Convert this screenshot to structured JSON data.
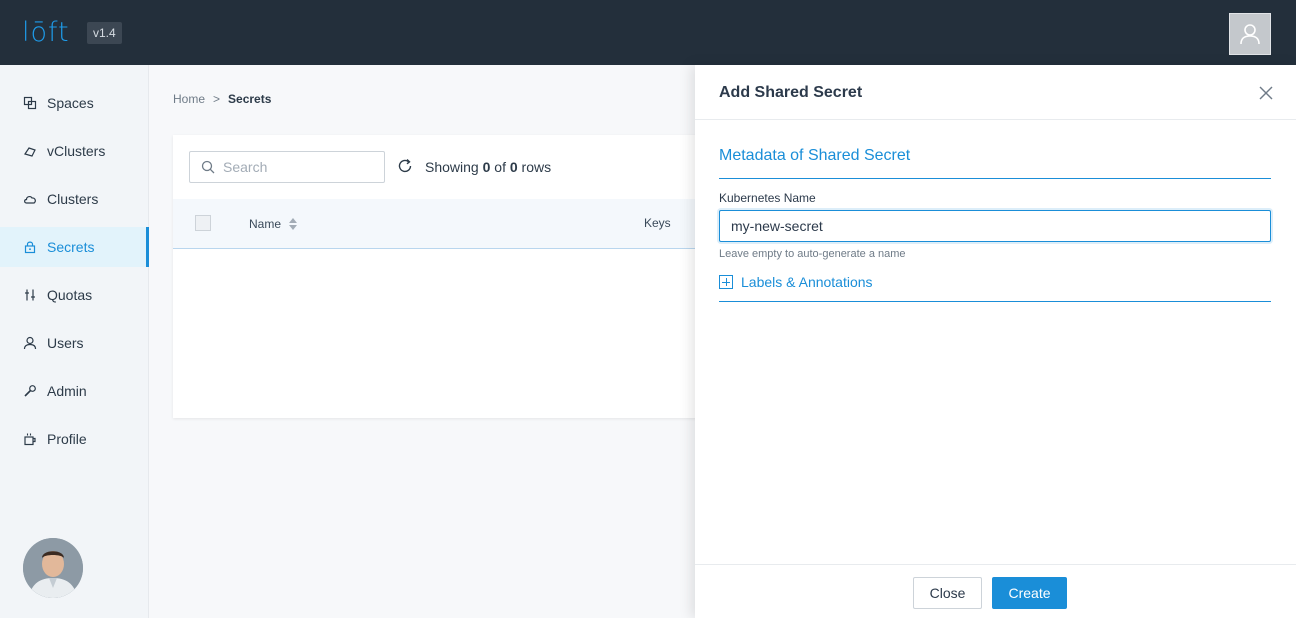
{
  "app": {
    "logo_text": "lōft",
    "version": "v1.4"
  },
  "sidebar": {
    "items": [
      {
        "label": "Spaces",
        "icon": "spaces-icon",
        "active": false
      },
      {
        "label": "vClusters",
        "icon": "vcluster-icon",
        "active": false
      },
      {
        "label": "Clusters",
        "icon": "cloud-icon",
        "active": false
      },
      {
        "label": "Secrets",
        "icon": "lock-icon",
        "active": true
      },
      {
        "label": "Quotas",
        "icon": "sliders-icon",
        "active": false
      },
      {
        "label": "Users",
        "icon": "user-icon",
        "active": false
      },
      {
        "label": "Admin",
        "icon": "wrench-icon",
        "active": false
      },
      {
        "label": "Profile",
        "icon": "coffee-icon",
        "active": false
      }
    ]
  },
  "breadcrumb": {
    "home": "Home",
    "separator": ">",
    "current": "Secrets"
  },
  "table": {
    "search_placeholder": "Search",
    "showing_prefix": "Showing",
    "showing_count": "0",
    "showing_of": "of",
    "showing_total": "0",
    "showing_suffix": "rows",
    "columns": [
      "Name",
      "Keys"
    ],
    "rows": []
  },
  "drawer": {
    "title": "Add Shared Secret",
    "section_title": "Metadata of Shared Secret",
    "field_label": "Kubernetes Name",
    "field_value": "my-new-secret",
    "field_hint": "Leave empty to auto-generate a name",
    "labels_link": "Labels & Annotations",
    "close_button": "Close",
    "create_button": "Create"
  },
  "colors": {
    "topbar": "#232f3b",
    "accent": "#1a8ed8",
    "logo": "#1e9be9"
  }
}
